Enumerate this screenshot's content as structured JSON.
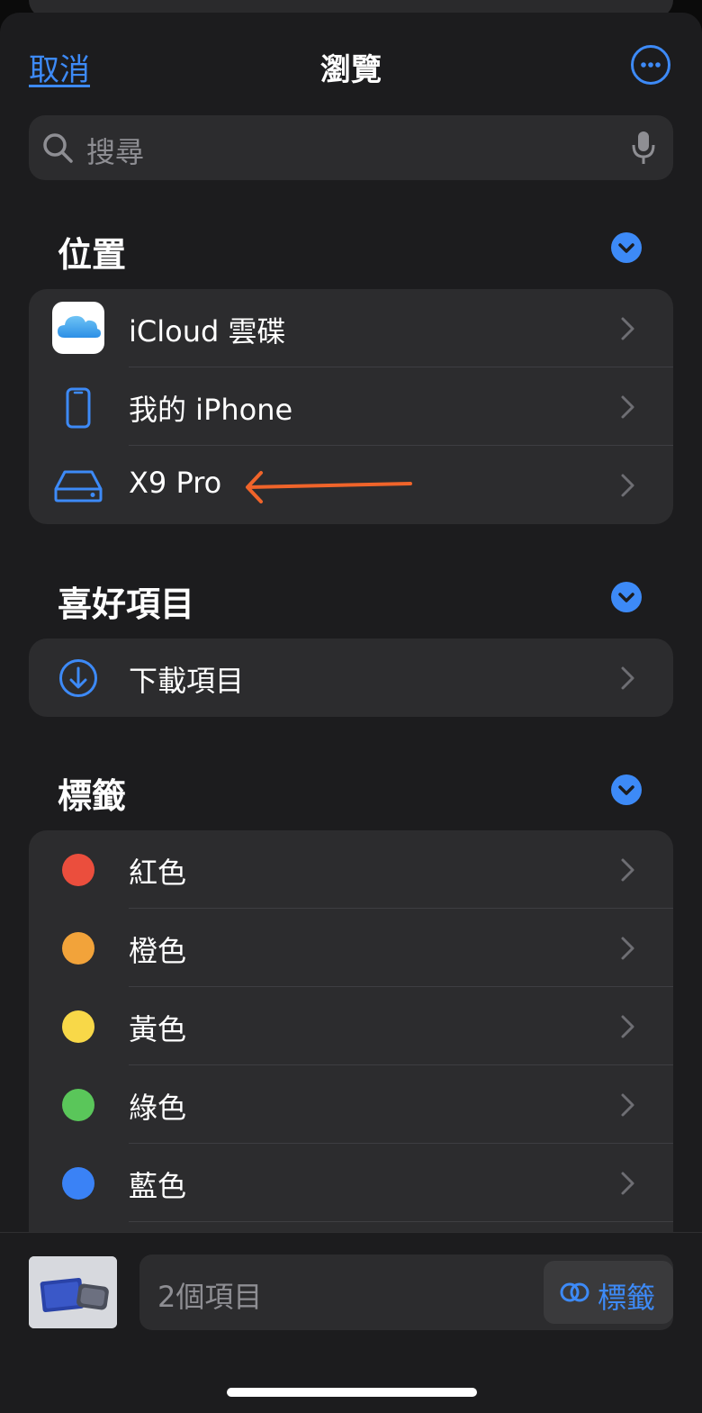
{
  "nav": {
    "cancel_label": "取消",
    "title": "瀏覽"
  },
  "search": {
    "placeholder": "搜尋"
  },
  "locations": {
    "title": "位置",
    "items": [
      {
        "label": "iCloud 雲碟",
        "icon": "icloud-icon"
      },
      {
        "label": "我的 iPhone",
        "icon": "iphone-icon"
      },
      {
        "label": "X9 Pro",
        "icon": "external-drive-icon"
      }
    ]
  },
  "favorites": {
    "title": "喜好項目",
    "items": [
      {
        "label": "下載項目",
        "icon": "download-icon"
      }
    ]
  },
  "tags": {
    "title": "標籤",
    "items": [
      {
        "label": "紅色",
        "color": "#eb4e3d"
      },
      {
        "label": "橙色",
        "color": "#f2a33a"
      },
      {
        "label": "黃色",
        "color": "#f8d848"
      },
      {
        "label": "綠色",
        "color": "#5ac65a"
      },
      {
        "label": "藍色",
        "color": "#3a82f6"
      }
    ]
  },
  "bottom": {
    "items_count": "2個項目",
    "tags_button_label": "標籤"
  },
  "colors": {
    "accent": "#3d8af7",
    "annotation_arrow": "#f0642a"
  }
}
